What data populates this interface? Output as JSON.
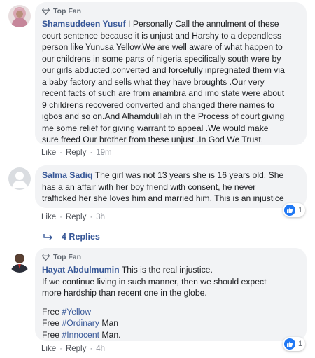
{
  "colors": {
    "link": "#385898",
    "bubble": "#f2f3f5",
    "like_blue": "#2078f4"
  },
  "comments": [
    {
      "badge": "Top Fan",
      "author": "Shamsuddeen Yusuf",
      "lines": [
        " I Personally Call the annulment of these",
        "court sentence because it is unjust and Harshy to a dependless",
        "person like Yunusa Yellow.We are well aware of what happen to",
        "our childrens in some parts of nigeria specifically south were by",
        "our girls abducted,converted and forcefully inpregnated them via",
        "a baby factory and sells what they have broughts .Our very",
        "recent facts of such are from anambra and imo state were about",
        "9 childrens recovered converted and changed there names to",
        "igbos and so on.And Alhamdulillah in the Process of court giving",
        "me some relief for giving warrant to appeal .We would make",
        "sure freed Our brother from these unjust .In God We Trust."
      ],
      "like": "Like",
      "reply": "Reply",
      "time": "19m"
    },
    {
      "author": "Salma Sadiq",
      "lines": [
        " The girl was not 13 years she is 16 years old. She",
        "has a an affair with her boy friend with consent, he never",
        "trafficked her she loves him and married him. This is an injustice"
      ],
      "like": "Like",
      "reply": "Reply",
      "time": "3h",
      "reaction_count": "1",
      "replies_label": "4 Replies"
    },
    {
      "badge": "Top Fan",
      "author": "Hayat Abdulmumin",
      "first_line": " This is the real injustice.",
      "lines": [
        "If we continue living in such manner, then we should expect",
        "more hardship than recent one in the globe."
      ],
      "free_lines": [
        {
          "prefix": "Free ",
          "tag": "#Yellow",
          "suffix": ""
        },
        {
          "prefix": "Free ",
          "tag": "#Ordinary",
          "suffix": " Man"
        },
        {
          "prefix": "Free ",
          "tag": "#Innocent",
          "suffix": " Man."
        }
      ],
      "like": "Like",
      "reply": "Reply",
      "time": "4h",
      "reaction_count": "1"
    }
  ]
}
